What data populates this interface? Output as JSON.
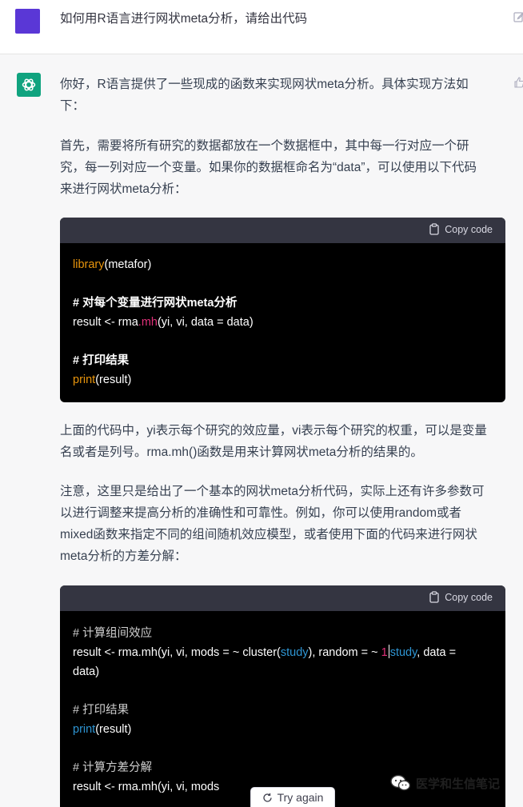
{
  "user": {
    "message": "如何用R语言进行网状meta分析，请给出代码"
  },
  "assistant": {
    "p1_line1": "你好，R语言提供了一些现成的函数来实现网状meta分析。具体实现方法如",
    "p1_line2": "下：",
    "p2_line1": "首先，需要将所有研究的数据都放在一个数据框中，其中每一行对应一个研",
    "p2_line2": "究，每一列对应一个变量。如果你的数据框命名为“data”，可以使用以下代码",
    "p2_line3": "来进行网状meta分析：",
    "p3_line1": "上面的代码中，yi表示每个研究的效应量，vi表示每个研究的权重，可以是变量",
    "p3_line2": "名或者是列号。rma.mh()函数是用来计算网状meta分析的结果的。",
    "p4_line1": "注意，这里只是给出了一个基本的网状meta分析代码，实际上还有许多参数可",
    "p4_line2": "以进行调整来提高分析的准确性和可靠性。例如，你可以使用random或者",
    "p4_line3": "mixed函数来指定不同的组间随机效应模型，或者使用下面的代码来进行网状",
    "p4_line4": "meta分析的方差分解："
  },
  "code1": {
    "copy_label": "Copy code",
    "l1_fn": "library",
    "l1_rest": "(metafor)",
    "l3_comment": "# 对每个变量进行网状meta分析",
    "l4_a": "result <- rma",
    "l4_b": ".mh",
    "l4_c": "(yi, vi, data = data)",
    "l6_comment": "# 打印结果",
    "l7_fn": "print",
    "l7_rest": "(result)"
  },
  "code2": {
    "copy_label": "Copy code",
    "l1_comment": "# 计算组间效应",
    "l2_a": "result <- rma.mh(yi, vi, mods = ~ cluster(",
    "l2_b": "study",
    "l2_c": "), random = ~ ",
    "l2_d": "1",
    "l2_e": "study",
    "l2_f": ", data =",
    "l3": "data)",
    "l5_comment": "# 打印结果",
    "l6_fn": "print",
    "l6_rest": "(result)",
    "l8_comment": "# 计算方差分解",
    "l9": "result <- rma.mh(yi, vi, mods"
  },
  "watermark": {
    "text": "医学和生信笔记"
  },
  "controls": {
    "try_again": "Try again"
  },
  "colors": {
    "user_avatar": "#5a37d6",
    "assistant_avatar": "#10a37f",
    "code_bg": "#000000",
    "code_header": "#343541"
  },
  "icons": [
    "edit-icon",
    "openai-logo-icon",
    "thumbs-up-icon",
    "clipboard-icon",
    "wechat-icon",
    "refresh-icon"
  ]
}
